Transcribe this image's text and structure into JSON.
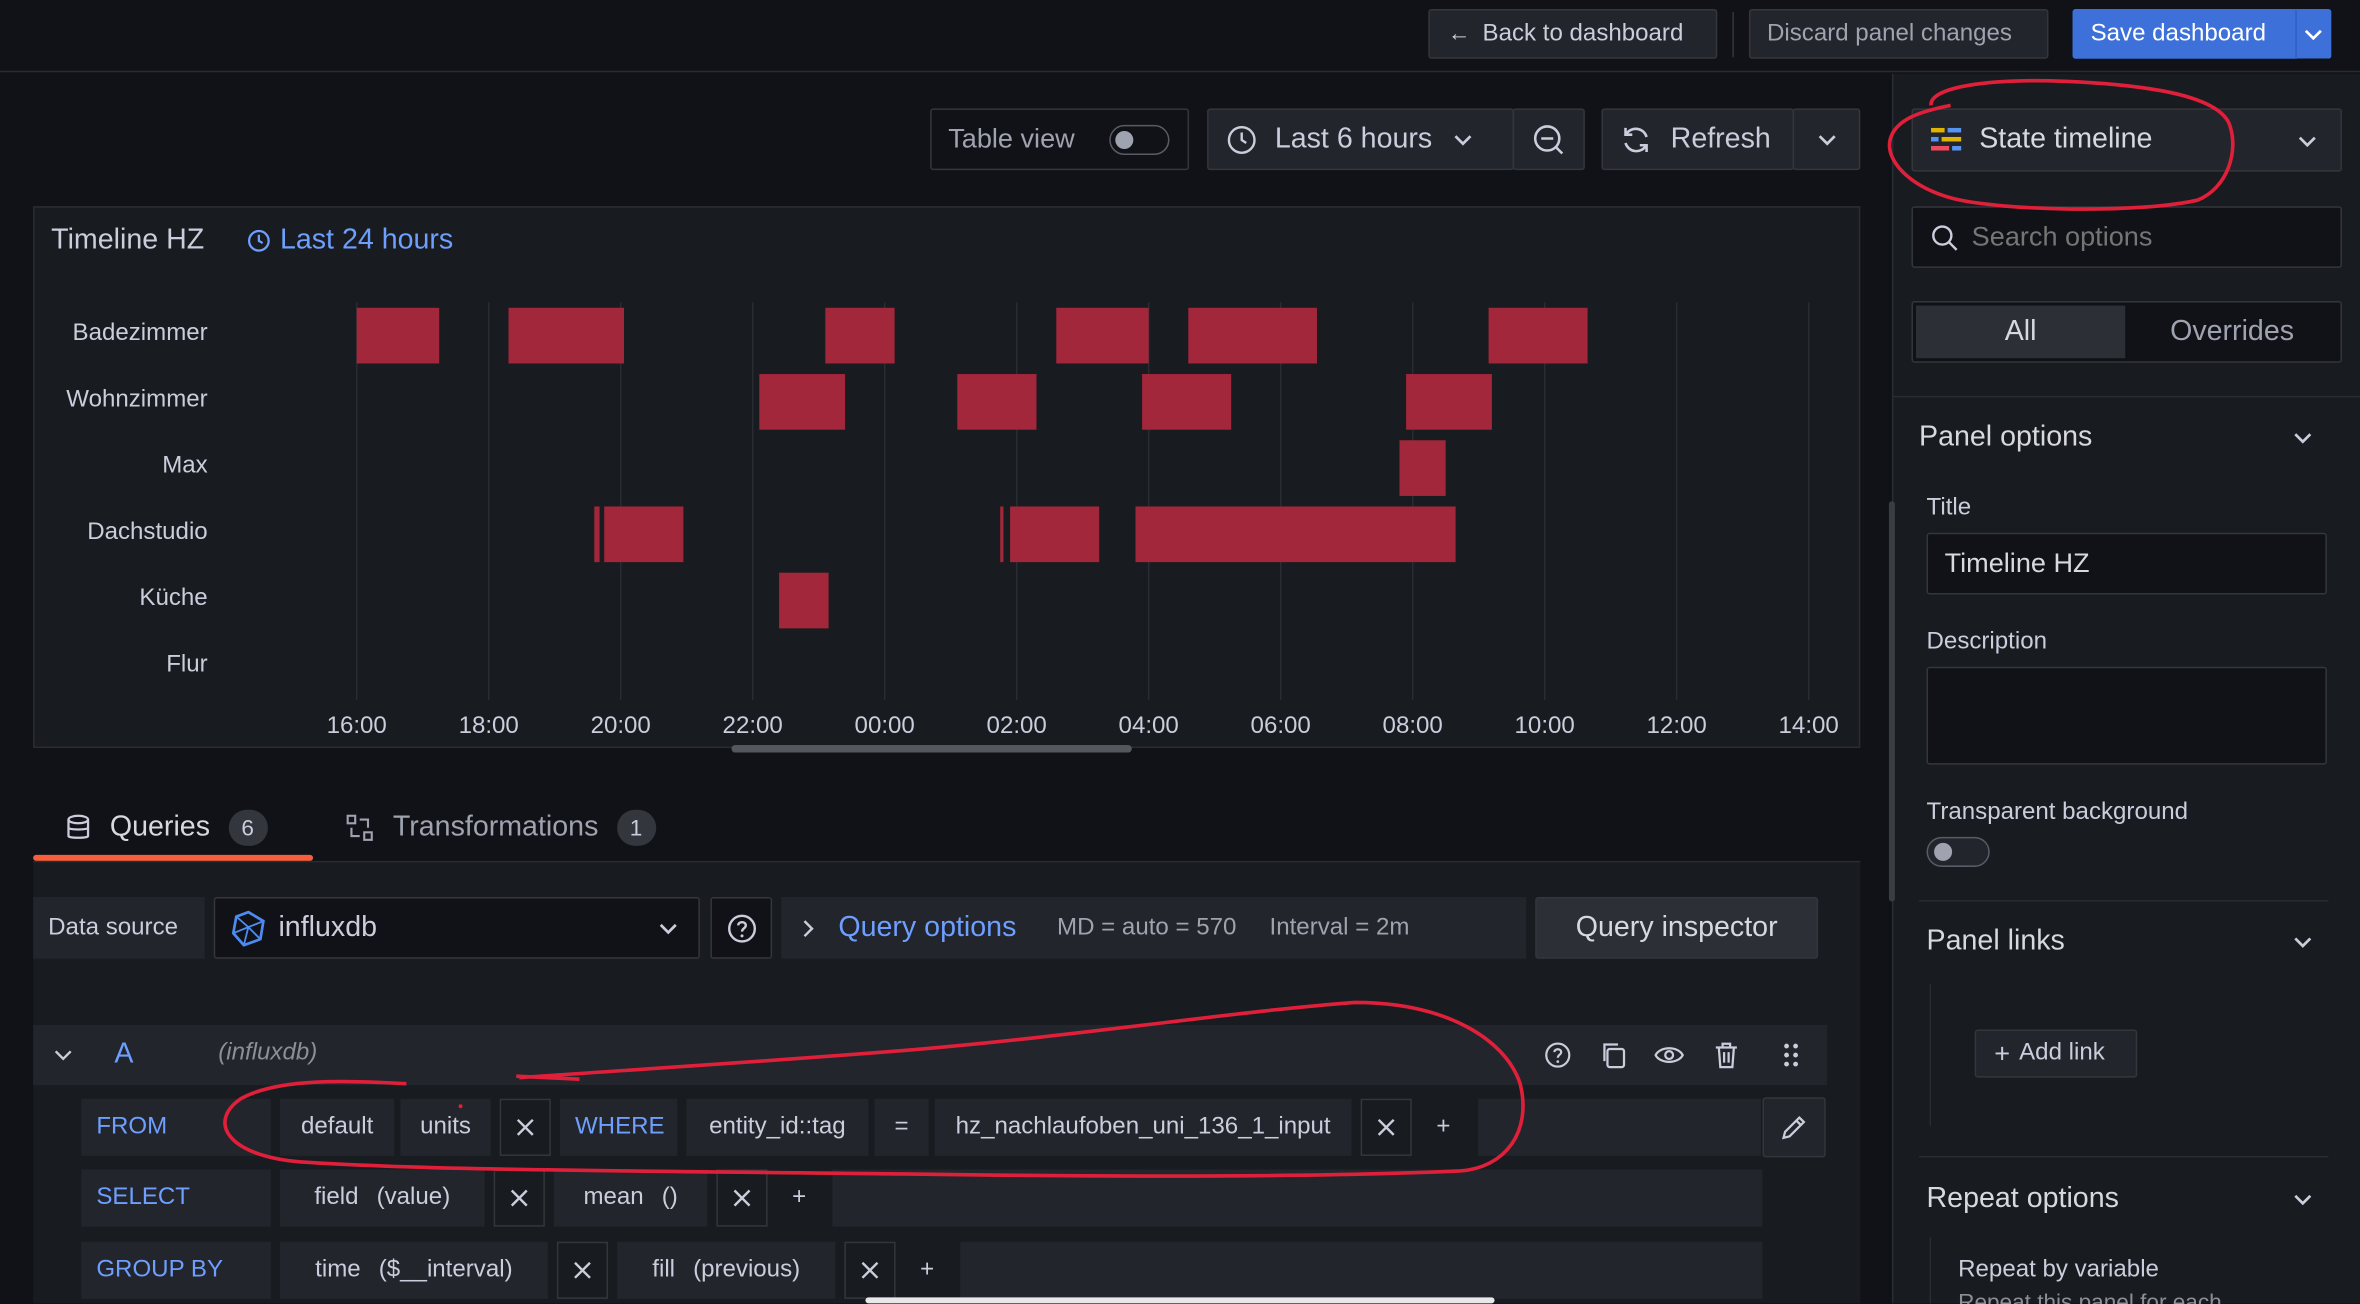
{
  "topbar": {
    "back_label": "Back to dashboard",
    "discard_label": "Discard panel changes",
    "save_label": "Save dashboard"
  },
  "toolbar": {
    "table_view_label": "Table view",
    "time_range_label": "Last 6 hours",
    "refresh_label": "Refresh"
  },
  "panel": {
    "title": "Timeline HZ",
    "time_override": "Last 24 hours"
  },
  "chart_data": {
    "type": "state-timeline",
    "rows": [
      "Badezimmer",
      "Wohnzimmer",
      "Max",
      "Dachstudio",
      "Küche",
      "Flur"
    ],
    "x_ticks": [
      "16:00",
      "18:00",
      "20:00",
      "22:00",
      "00:00",
      "02:00",
      "04:00",
      "06:00",
      "08:00",
      "10:00",
      "12:00",
      "14:00"
    ],
    "x_range_hours": [
      0,
      22
    ],
    "series_color": "#a2273a",
    "intervals": [
      {
        "row": 0,
        "start": 0.0,
        "end": 1.25
      },
      {
        "row": 0,
        "start": 2.3,
        "end": 4.05
      },
      {
        "row": 0,
        "start": 7.1,
        "end": 8.15
      },
      {
        "row": 0,
        "start": 10.6,
        "end": 12.0
      },
      {
        "row": 0,
        "start": 12.6,
        "end": 14.55
      },
      {
        "row": 0,
        "start": 17.15,
        "end": 18.65
      },
      {
        "row": 1,
        "start": 6.1,
        "end": 7.4
      },
      {
        "row": 1,
        "start": 9.1,
        "end": 10.3
      },
      {
        "row": 1,
        "start": 11.9,
        "end": 13.25
      },
      {
        "row": 1,
        "start": 15.9,
        "end": 17.2
      },
      {
        "row": 2,
        "start": 15.8,
        "end": 16.5
      },
      {
        "row": 3,
        "start": 3.6,
        "end": 3.68
      },
      {
        "row": 3,
        "start": 3.75,
        "end": 4.95
      },
      {
        "row": 3,
        "start": 9.75,
        "end": 9.8
      },
      {
        "row": 3,
        "start": 9.9,
        "end": 11.25
      },
      {
        "row": 3,
        "start": 11.8,
        "end": 16.65
      },
      {
        "row": 4,
        "start": 6.4,
        "end": 7.15
      }
    ]
  },
  "tabs": {
    "queries_label": "Queries",
    "queries_count": "6",
    "transformations_label": "Transformations",
    "transformations_count": "1"
  },
  "query": {
    "datasource_label": "Data source",
    "datasource_value": "influxdb",
    "query_options_label": "Query options",
    "md_text": "MD = auto = 570",
    "interval_text": "Interval = 2m",
    "inspector_label": "Query inspector",
    "ref_id": "A",
    "ref_ds": "(influxdb)",
    "from_kw": "FROM",
    "from_db": "default",
    "from_measurement": "units",
    "where_kw": "WHERE",
    "where_key": "entity_id::tag",
    "where_op": "=",
    "where_value": "hz_nachlaufoben_uni_136_1_input",
    "select_kw": "SELECT",
    "select_field": "field",
    "select_field_arg": "(value)",
    "select_fn": "mean",
    "select_fn_arg": "()",
    "groupby_kw": "GROUP BY",
    "groupby_time": "time",
    "groupby_time_arg": "($__interval)",
    "groupby_fill": "fill",
    "groupby_fill_arg": "(previous)",
    "plus": "+"
  },
  "options": {
    "viz_label": "State timeline",
    "search_placeholder": "Search options",
    "tab_all": "All",
    "tab_overrides": "Overrides",
    "panel_options_header": "Panel options",
    "title_label": "Title",
    "title_value": "Timeline HZ",
    "description_label": "Description",
    "transparent_label": "Transparent background",
    "panel_links_header": "Panel links",
    "add_link_label": "Add link",
    "repeat_header": "Repeat options",
    "repeat_by_label": "Repeat by variable",
    "repeat_desc": "Repeat this panel for each"
  },
  "colors": {
    "accent_blue": "#3d71d9",
    "link_blue": "#6e9fff",
    "annotation_red": "#e0203a",
    "tab_underline": "#f55f3e"
  }
}
